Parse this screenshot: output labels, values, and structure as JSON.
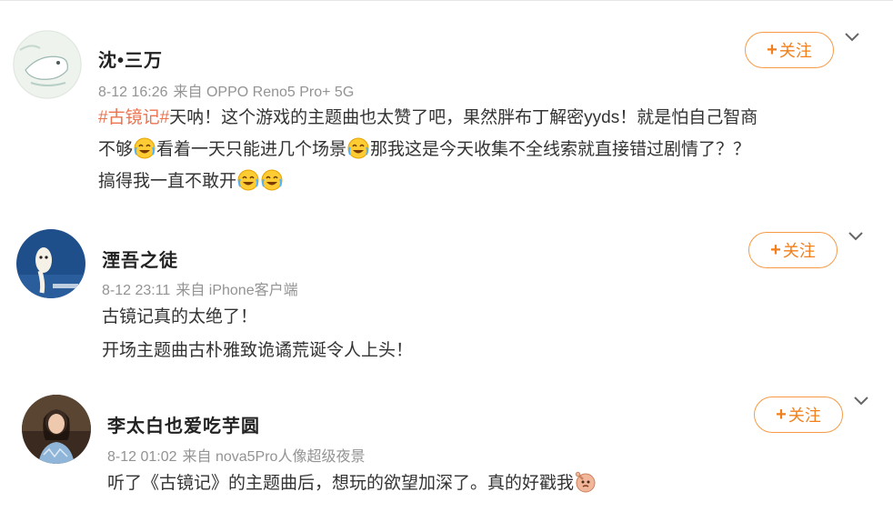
{
  "comments": [
    {
      "username": "沈•三万",
      "time": "8-12 16:26",
      "source": "来自 OPPO Reno5 Pro+ 5G",
      "follow_label": "关注",
      "hashtag": "#古镜记#",
      "line1": "天呐！这个游戏的主题曲也太赞了吧，果然胖布丁解密yyds！就是怕自己智商",
      "line2a": "不够",
      "line2b": "看着一天只能进几个场景",
      "line2c": "那我这是今天收集不全线索就直接错过剧情了？？",
      "line3": "搞得我一直不敢开"
    },
    {
      "username": "湮吾之徒",
      "time": "8-12 23:11",
      "source": "来自 iPhone客户端",
      "follow_label": "关注",
      "line1": "古镜记真的太绝了！",
      "line2": "开场主题曲古朴雅致诡谲荒诞令人上头！"
    },
    {
      "username": "李太白也爱吃芋圆",
      "time": "8-12 01:02",
      "source": "来自 nova5Pro人像超级夜景",
      "follow_label": "关注",
      "line1": "听了《古镜记》的主题曲后，想玩的欲望加深了。真的好戳我"
    }
  ],
  "icons": {
    "follow_plus": "+",
    "more": "chevron-down-icon",
    "emoji_cry": "laugh-cry-emoji",
    "emoji_poke": "poke-emoji"
  },
  "colors": {
    "accent": "#f27f1b",
    "hashtag": "#eb7350",
    "meta": "#939393"
  }
}
